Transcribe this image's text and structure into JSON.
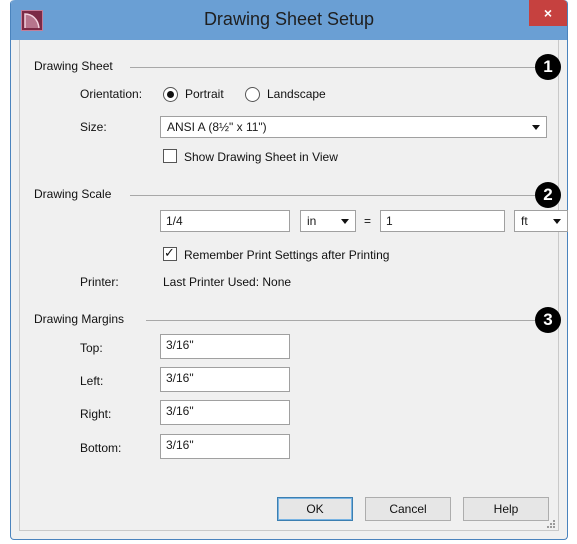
{
  "window": {
    "title": "Drawing Sheet Setup",
    "close": "×"
  },
  "drawing_sheet": {
    "heading": "Drawing Sheet",
    "badge": "1",
    "orientation_label": "Orientation:",
    "portrait": "Portrait",
    "landscape": "Landscape",
    "orientation_selected": "Portrait",
    "size_label": "Size:",
    "size_value": "ANSI A  (8½\" x 11\")",
    "show_sheet_label": "Show Drawing Sheet in View",
    "show_sheet_checked": false
  },
  "drawing_scale": {
    "heading": "Drawing Scale",
    "badge": "2",
    "scale_value": "1/4",
    "scale_unit": "in",
    "equals": "=",
    "paper_value": "1",
    "paper_unit": "ft",
    "remember_label": "Remember Print Settings after Printing",
    "remember_checked": true,
    "printer_label": "Printer:",
    "printer_value": "Last Printer Used: None"
  },
  "drawing_margins": {
    "heading": "Drawing Margins",
    "badge": "3",
    "top_label": "Top:",
    "top_value": "3/16\"",
    "left_label": "Left:",
    "left_value": "3/16\"",
    "right_label": "Right:",
    "right_value": "3/16\"",
    "bottom_label": "Bottom:",
    "bottom_value": "3/16\""
  },
  "buttons": {
    "ok": "OK",
    "cancel": "Cancel",
    "help": "Help"
  },
  "icons": {
    "app": "app-logo-icon",
    "dropdown": "chevron-down-icon",
    "check": "checkmark-icon",
    "resize": "resize-grip-icon"
  },
  "colors": {
    "titlebar": "#6a9fd4",
    "close": "#c6413f",
    "badge": "#000000",
    "dialog_bg": "#f0f0f0"
  }
}
